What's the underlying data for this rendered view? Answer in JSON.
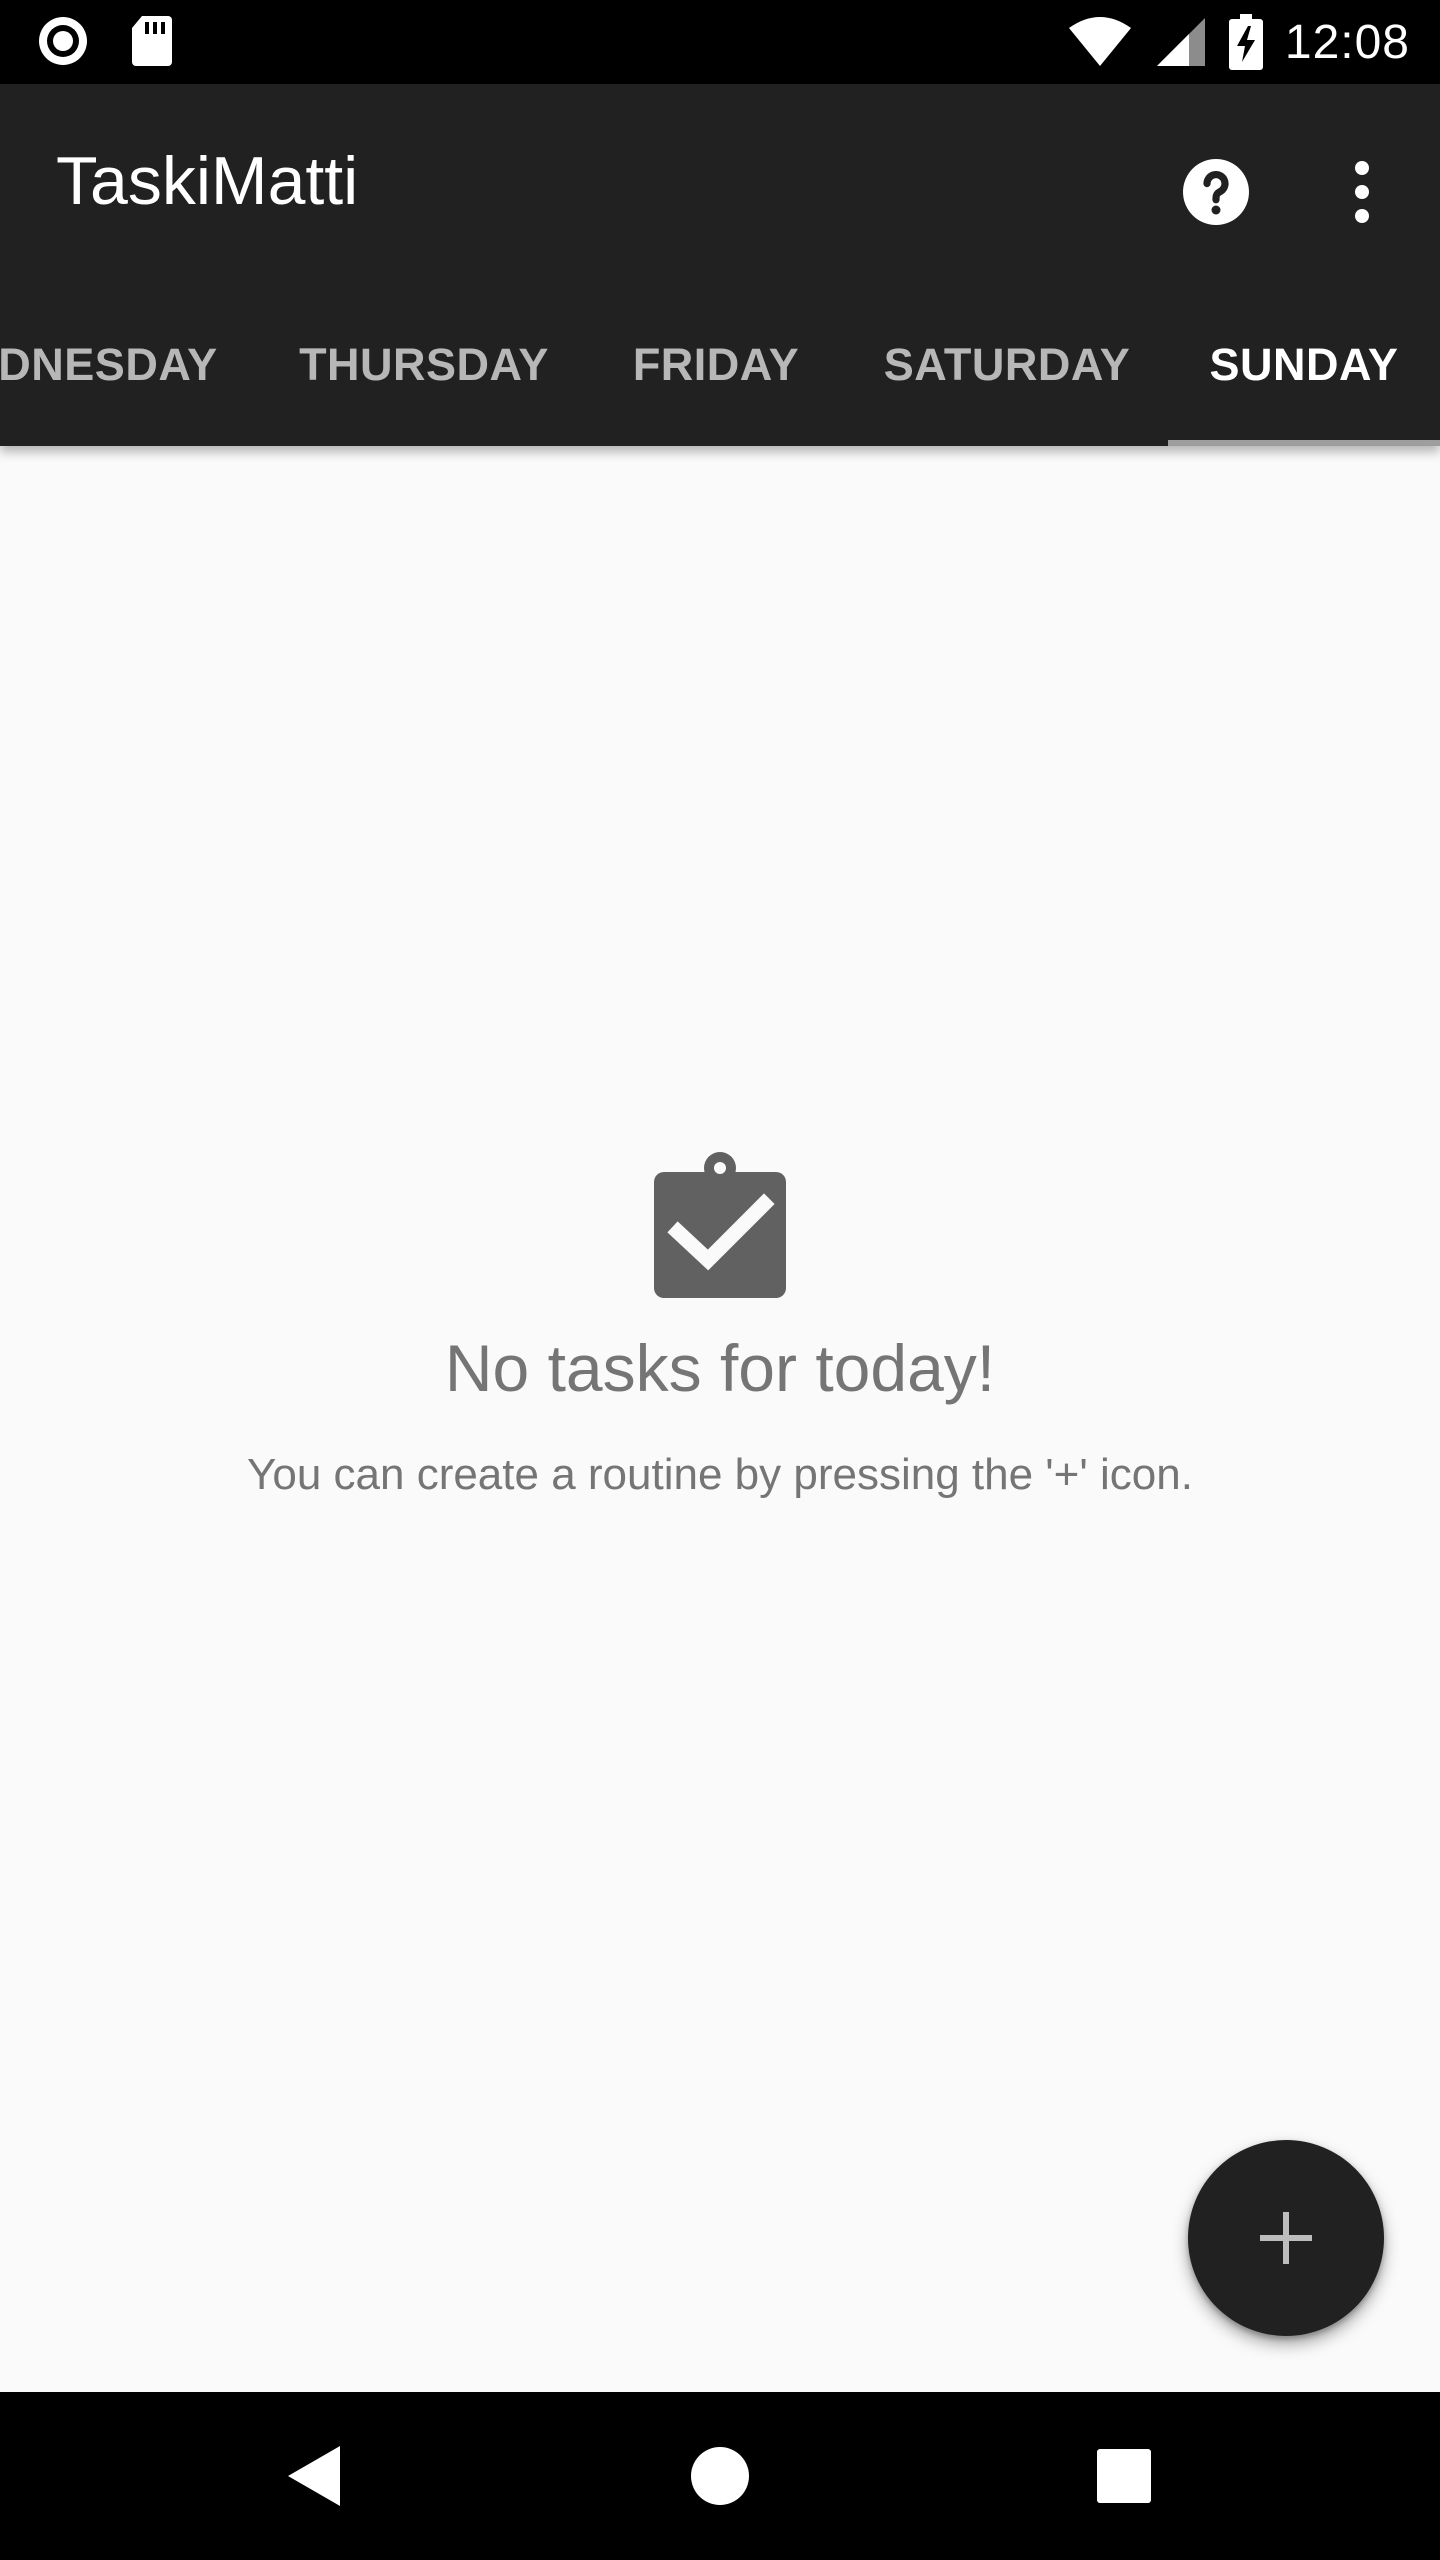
{
  "status_bar": {
    "time": "12:08",
    "left_icons": [
      "record-icon",
      "sd-card-icon"
    ],
    "right_icons": [
      "wifi-icon",
      "cell-signal-icon",
      "battery-charging-icon"
    ]
  },
  "app_bar": {
    "title": "TaskiMatti",
    "actions": [
      "help-icon",
      "more-vert-icon"
    ],
    "background_color": "#212121"
  },
  "tabs": {
    "items": [
      {
        "label": "DNESDAY"
      },
      {
        "label": "THURSDAY"
      },
      {
        "label": "FRIDAY"
      },
      {
        "label": "SATURDAY"
      },
      {
        "label": "SUNDAY"
      }
    ],
    "selected": "SUNDAY"
  },
  "empty_state": {
    "icon": "clipboard-check-icon",
    "title": "No tasks for today!",
    "subtitle": "You can create a routine by pressing the '+' icon."
  },
  "fab": {
    "icon": "plus-icon"
  },
  "nav_bar": {
    "buttons": [
      "back-icon",
      "home-icon",
      "recents-icon"
    ]
  }
}
